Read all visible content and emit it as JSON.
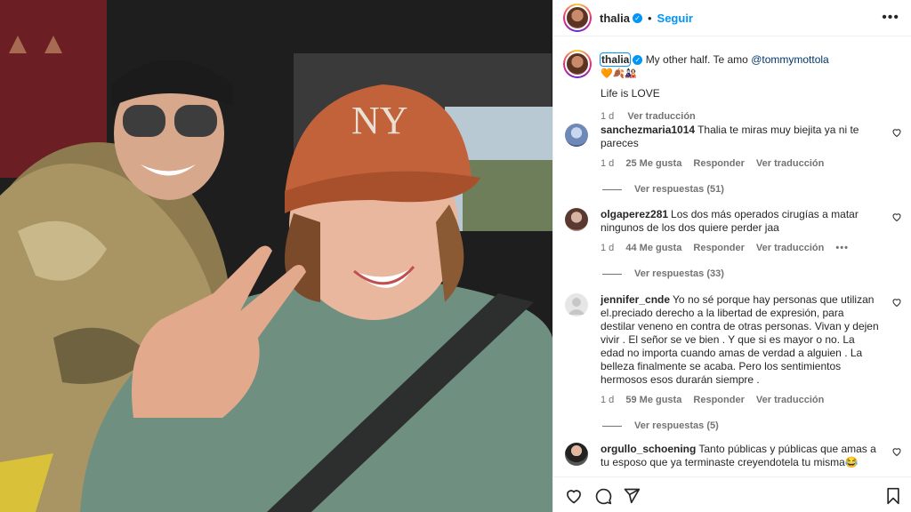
{
  "post": {
    "author": "thalia",
    "follow_label": "Seguir",
    "separator": "•",
    "more_label": "•••",
    "caption_text": "My other half. Te amo ",
    "caption_mention": "@tommymottola",
    "caption_emojis": "🧡🍂🎎",
    "caption_line2": "Life is LOVE",
    "caption_time": "1 d",
    "caption_translate": "Ver traducción"
  },
  "comments": [
    {
      "user": "sanchezmaria1014",
      "text": "Thalia te miras muy biejita ya ni te pareces",
      "time": "1 d",
      "likes": "25 Me gusta",
      "reply": "Responder",
      "translate": "Ver traducción",
      "replies": "Ver respuestas (51)"
    },
    {
      "user": "olgaperez281",
      "text": "Los dos más operados cirugías a matar ningunos de los dos quiere perder jaa",
      "time": "1 d",
      "likes": "44 Me gusta",
      "reply": "Responder",
      "translate": "Ver traducción",
      "more": "•••",
      "replies": "Ver respuestas (33)"
    },
    {
      "user": "jennifer_cnde",
      "text": "Yo no sé porque hay personas que utilizan el.preciado derecho a la libertad de expresión, para destilar veneno en contra de otras personas. Vivan y dejen vivir . El señor se ve bien . Y que si es mayor o no. La edad no importa cuando amas de verdad a alguien . La belleza finalmente se acaba. Pero los sentimientos hermosos esos durarán siempre .",
      "time": "1 d",
      "likes": "59 Me gusta",
      "reply": "Responder",
      "translate": "Ver traducción",
      "replies": "Ver respuestas (5)"
    },
    {
      "user": "orgullo_schoening",
      "text": "Tanto públicas y públicas que amas a tu esposo que ya terminaste creyendotela tu misma😂"
    }
  ],
  "colors": {
    "accent": "#0095f6",
    "verified": "#0095f6",
    "mention": "#00376b",
    "muted": "#737373"
  },
  "icons": [
    "verified-badge-icon",
    "more-options-icon",
    "heart-icon",
    "comment-icon",
    "share-icon",
    "bookmark-icon"
  ]
}
